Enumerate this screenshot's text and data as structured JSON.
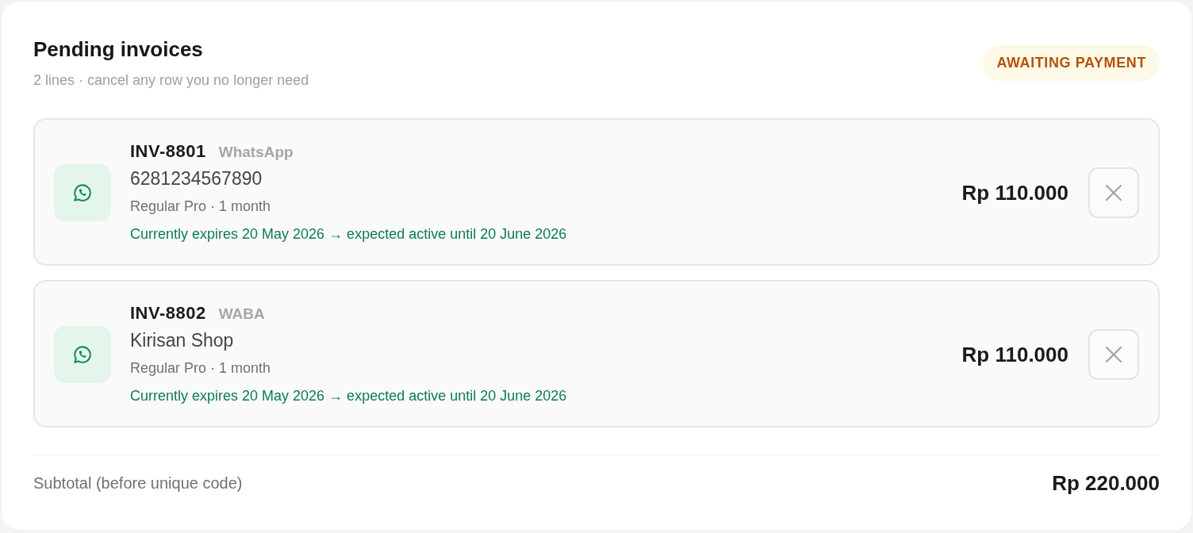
{
  "header": {
    "title": "Pending invoices",
    "subtitle": "2 lines · cancel any row you no longer need",
    "status_badge": "AWAITING PAYMENT"
  },
  "invoices": [
    {
      "number": "INV-8801",
      "channel": "WhatsApp",
      "account": "6281234567890",
      "plan": "Regular Pro · 1 month",
      "renewal": "Currently expires 20 May 2026 → expected active until 20 June 2026",
      "amount": "Rp 110.000"
    },
    {
      "number": "INV-8802",
      "channel": "WABA",
      "account": "Kirisan Shop",
      "plan": "Regular Pro · 1 month",
      "renewal": "Currently expires 20 May 2026 → expected active until 20 June 2026",
      "amount": "Rp 110.000"
    }
  ],
  "summary": {
    "label": "Subtotal (before unique code)",
    "amount": "Rp 220.000"
  }
}
